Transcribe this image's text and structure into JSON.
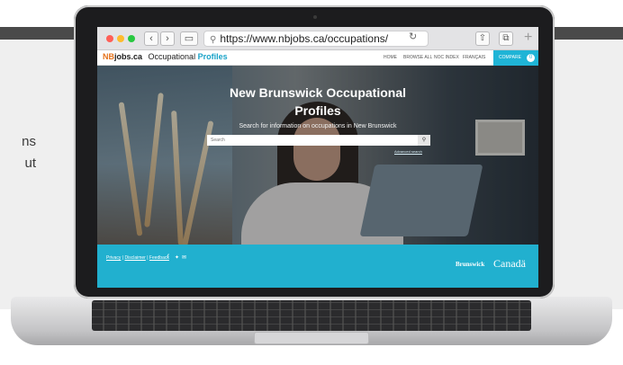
{
  "side_text": {
    "line1": "ns",
    "line2": "ut"
  },
  "browser": {
    "url": "https://www.nbjobs.ca/occupations/",
    "reload_icon": "refresh-icon",
    "share_icon": "share-icon",
    "tabs_icon": "tabs-icon"
  },
  "site": {
    "logo_prefix": "NB",
    "logo_domain": "jobs.ca",
    "logo_occupational": "Occupational",
    "logo_profiles": "Profiles",
    "menu": [
      "HOME",
      "BROWSE ALL",
      "NOC INDEX",
      "FRANÇAIS"
    ],
    "compare_label": "COMPARE",
    "compare_count": "0",
    "brand_color": "#1fb4d6"
  },
  "hero": {
    "title_line1": "New Brunswick Occupational",
    "title_line2": "Profiles",
    "subtitle": "Search for information on occupations in New Brunswick",
    "search_placeholder": "Search",
    "advanced_search": "Advanced search"
  },
  "footer": {
    "privacy": "Privacy",
    "disclaimer": "Disclaimer",
    "feedback": "Feedback",
    "brunswick": "Brunswick",
    "canada": "Canadä"
  }
}
